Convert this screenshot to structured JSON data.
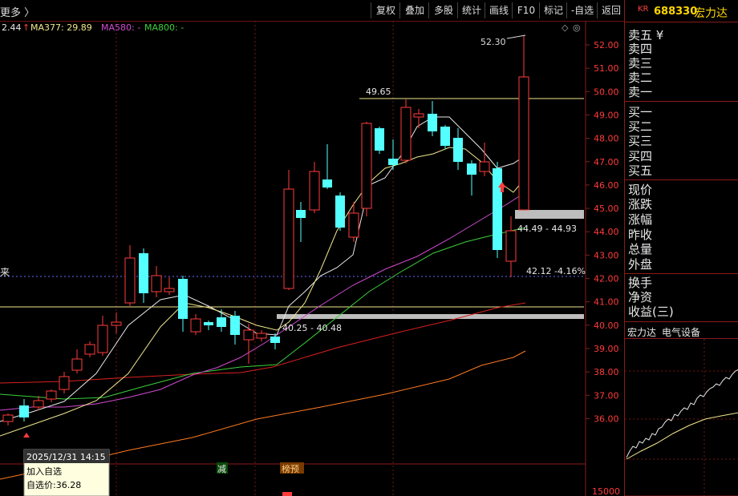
{
  "toolbar": {
    "more_label": "更多 〉",
    "buttons": [
      "复权",
      "叠加",
      "多股",
      "统计",
      "画线",
      "F10",
      "标记",
      "-自选",
      "返回"
    ]
  },
  "ma_legend": {
    "first": "2.44",
    "ma377": "MA377: 29.89",
    "ma580": "MA580: -",
    "ma800": "MA800: -"
  },
  "price_axis": {
    "ticks": [
      "52.00",
      "51.00",
      "50.00",
      "49.00",
      "48.00",
      "47.00",
      "46.00",
      "45.00",
      "44.00",
      "43.00",
      "42.00",
      "41.00",
      "40.00",
      "39.00",
      "38.00",
      "37.00",
      "36.00"
    ],
    "bottom_tick": "15000"
  },
  "annotations": {
    "high": "52.30",
    "level_49": "49.65",
    "range_upper": "44.49 - 44.93",
    "range_lower": "40.25 - 40.48",
    "last": "42.12 -4.16%",
    "left_edge": "来"
  },
  "markers": {
    "jian": "减",
    "bangyu": "榜预"
  },
  "tooltip": {
    "datetime": "2025/12/31 14:15",
    "add_watch": "加入自选",
    "watch_price": "自选价:36.28"
  },
  "right_panel": {
    "code_prefix": "KR",
    "code": "688330",
    "name": "宏力达",
    "sell_rows": [
      "卖五 ¥",
      "卖四",
      "卖三",
      "卖二",
      "卖一"
    ],
    "buy_rows": [
      "买一",
      "买二",
      "买三",
      "买四",
      "买五"
    ],
    "quote_rows": [
      "现价",
      "涨跌",
      "涨幅",
      "昨收",
      "总量",
      "外盘"
    ],
    "extra_rows": [
      "换手",
      "净资",
      "收益(三)"
    ],
    "industry_name": "宏力达",
    "industry": "电气设备"
  },
  "colors": {
    "up": "#ff3b3b",
    "down": "#54ffff",
    "ma_white": "#e8e8e8",
    "ma_yellow": "#f0e68c",
    "ma_magenta": "#d24bd2",
    "ma_green": "#3ad03a",
    "ma_red": "#d82020",
    "ma_orange": "#ff7a20"
  }
}
